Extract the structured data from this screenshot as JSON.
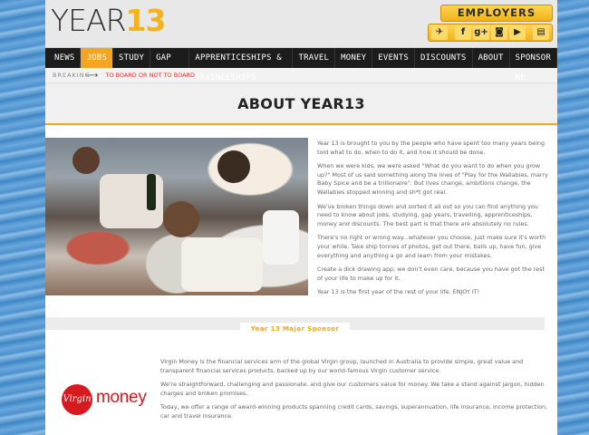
{
  "header": {
    "logo_year": "YEAR",
    "logo_num": "13",
    "employers_label": "EMPLOYERS",
    "social": [
      {
        "icon": "deliver-icon",
        "glyph": "✈"
      },
      {
        "icon": "facebook-icon",
        "glyph": "f"
      },
      {
        "icon": "google-plus-icon",
        "glyph": "g+"
      },
      {
        "icon": "instagram-icon",
        "glyph": "◙"
      },
      {
        "icon": "youtube-icon",
        "glyph": "▶"
      },
      {
        "icon": "magazine-icon",
        "glyph": "▤"
      }
    ]
  },
  "nav": {
    "items": [
      "NEWS",
      "JOBS",
      "STUDY",
      "GAP YEARS",
      "APPRENTICESHIPS & TRAINEESHIPS",
      "TRAVEL",
      "MONEY",
      "EVENTS",
      "DISCOUNTS",
      "ABOUT",
      "SPONSOR ME"
    ],
    "active": "JOBS"
  },
  "breaking": {
    "label": "BREAKING",
    "headline": "TO BOARD OR NOT TO BOARD"
  },
  "page_title": "ABOUT YEAR13",
  "about": {
    "paragraphs": [
      "Year 13 is brought to you by the people who have spent too many years being told what to do, when to do it, and how it should be done.",
      "When we were kids, we were asked \"What do you want to do when you grow up?\" Most of us said something along the lines of \"Play for the Wallabies, marry Baby Spice and be a trillionaire\". But lives change, ambitions change, the Wallabies stopped winning and sh*t got real.",
      "We've broken things down and sorted it all out so you can find anything you need to know about jobs, studying, gap years, travelling, apprenticeships, money and discounts. The best part is that there are absolutely no rules.",
      "There's no right or wrong way...whatever you choose, just make sure it's worth your while. Take ship tonnes of photos, get out there, balls up, have fun, give everything and anything a go and learn from your mistakes.",
      "Create a dick drawing app; we don't even care, because you have got the rest of your life to make up for it.",
      "Year 13 is the first year of the rest of your life. ENJOY IT!"
    ]
  },
  "sponsor": {
    "heading": "Year 13 Major Sponsor",
    "logo_script": "Virgin",
    "logo_word": "money",
    "paragraphs": [
      "Virgin Money is the financial services arm of the global Virgin group, launched in Australia to provide simple, great value and transparent financial services products, backed up by our world-famous Virgin customer service.",
      "We're straightforward, challenging and passionate, and give our customers value for money. We take a stand against jargon, hidden charges and broken promises.",
      "Today, we offer a range of award-winning products spanning credit cards, savings, superannuation, life insurance, income protection, car and travel insurance."
    ]
  }
}
